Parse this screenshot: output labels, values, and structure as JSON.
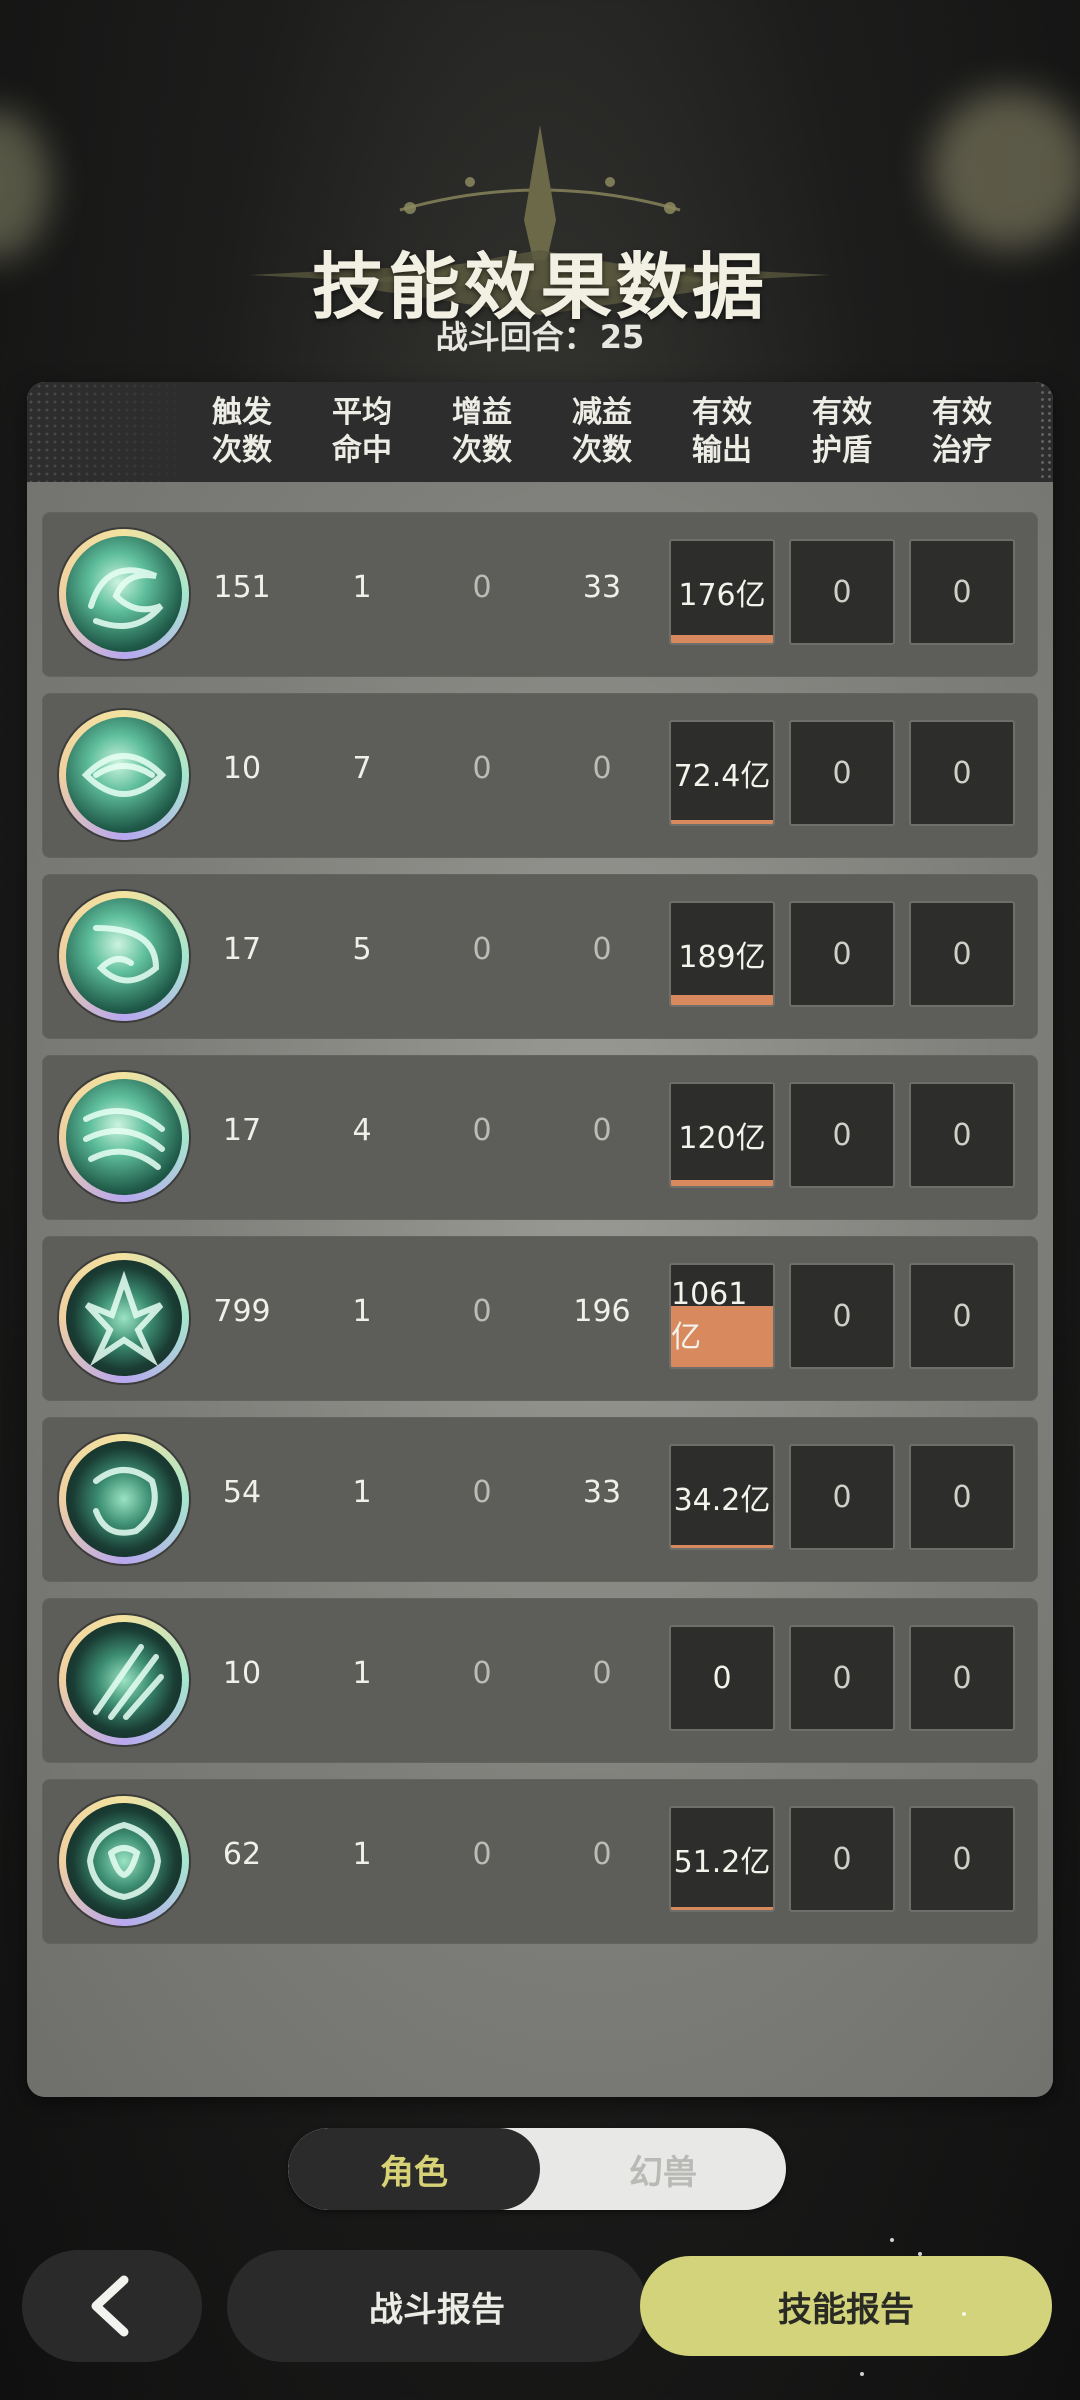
{
  "title": "技能效果数据",
  "subtitle": {
    "label": "战斗回合：",
    "value": "25"
  },
  "columns": [
    [
      "触发",
      "次数"
    ],
    [
      "平均",
      "命中"
    ],
    [
      "增益",
      "次数"
    ],
    [
      "减益",
      "次数"
    ],
    [
      "有效",
      "输出"
    ],
    [
      "有效",
      "护盾"
    ],
    [
      "有效",
      "治疗"
    ]
  ],
  "rows": [
    {
      "icon": "wind-vortex-skill-icon",
      "trigger": "151",
      "avg_hit": "1",
      "buff": "0",
      "debuff": "33",
      "output": "176亿",
      "output_fill": 0.08,
      "shield": "0",
      "heal": "0"
    },
    {
      "icon": "wind-orb-skill-icon",
      "trigger": "10",
      "avg_hit": "7",
      "buff": "0",
      "debuff": "0",
      "output": "72.4亿",
      "output_fill": 0.04,
      "shield": "0",
      "heal": "0"
    },
    {
      "icon": "wind-spiral-skill-icon",
      "trigger": "17",
      "avg_hit": "5",
      "buff": "0",
      "debuff": "0",
      "output": "189亿",
      "output_fill": 0.1,
      "shield": "0",
      "heal": "0"
    },
    {
      "icon": "wind-gust-skill-icon",
      "trigger": "17",
      "avg_hit": "4",
      "buff": "0",
      "debuff": "0",
      "output": "120亿",
      "output_fill": 0.06,
      "shield": "0",
      "heal": "0"
    },
    {
      "icon": "wind-claw-skill-icon",
      "trigger": "799",
      "avg_hit": "1",
      "buff": "0",
      "debuff": "196",
      "output": "1061亿",
      "output_fill": 0.6,
      "shield": "0",
      "heal": "0"
    },
    {
      "icon": "wind-ring-skill-icon",
      "trigger": "54",
      "avg_hit": "1",
      "buff": "0",
      "debuff": "33",
      "output": "34.2亿",
      "output_fill": 0.03,
      "shield": "0",
      "heal": "0"
    },
    {
      "icon": "wind-slash-skill-icon",
      "trigger": "10",
      "avg_hit": "1",
      "buff": "0",
      "debuff": "0",
      "output": "0",
      "output_fill": 0,
      "shield": "0",
      "heal": "0"
    },
    {
      "icon": "wind-emblem-skill-icon",
      "trigger": "62",
      "avg_hit": "1",
      "buff": "0",
      "debuff": "0",
      "output": "51.2亿",
      "output_fill": 0.03,
      "shield": "0",
      "heal": "0"
    }
  ],
  "toggle": {
    "active": "角色",
    "inactive": "幻兽"
  },
  "buttons": {
    "back_icon": "chevron-left-icon",
    "battle_report": "战斗报告",
    "skill_report": "技能报告"
  },
  "colors": {
    "accent": "#d2d37a",
    "output_bar": "#d88a5e",
    "panel": "#7f7f7b",
    "header": "#2d2d2d"
  }
}
